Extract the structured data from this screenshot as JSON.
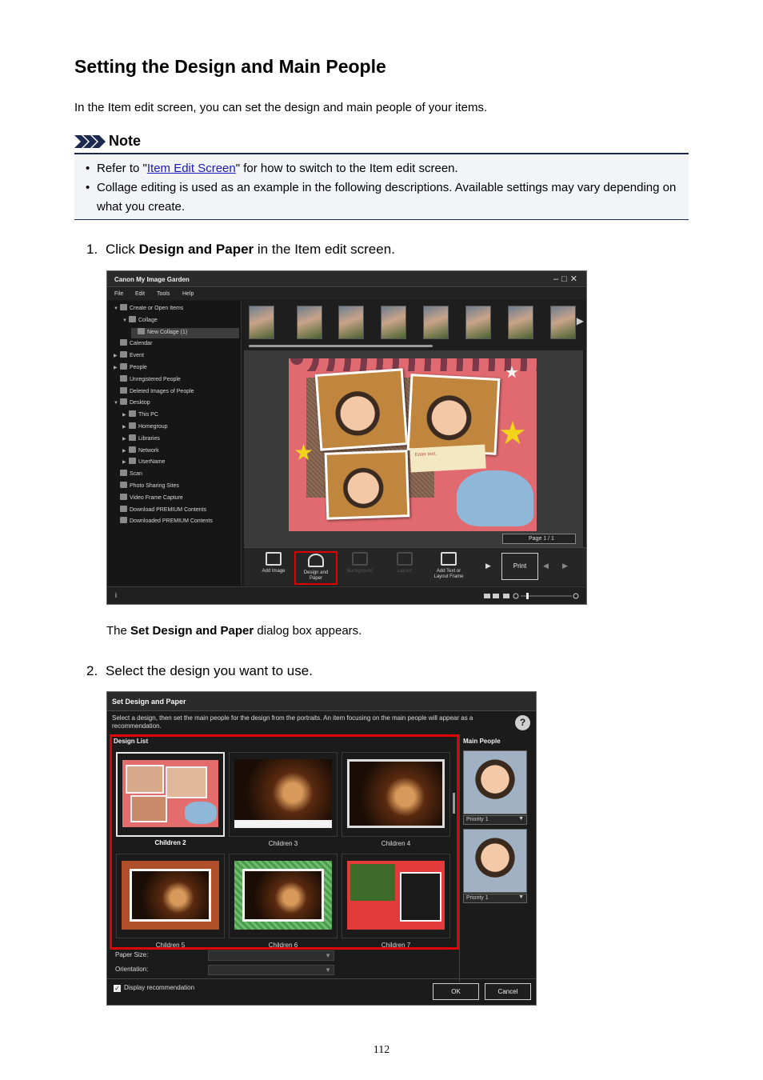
{
  "doc": {
    "title": "Setting the Design and Main People",
    "intro": "In the Item edit screen, you can set the design and main people of your items.",
    "note": {
      "label": "Note",
      "item1_pre": "Refer to \"",
      "item1_link": "Item Edit Screen",
      "item1_post": "\" for how to switch to the Item edit screen.",
      "item2": "Collage editing is used as an example in the following descriptions. Available settings may vary depending on what you create."
    },
    "step1": {
      "num": "1.",
      "pre": "Click ",
      "bold": "Design and Paper",
      "post": " in the Item edit screen."
    },
    "after1": {
      "pre": "The ",
      "bold": "Set Design and Paper",
      "post": " dialog box appears."
    },
    "step2": {
      "num": "2.",
      "text": "Select the design you want to use."
    },
    "page_number": "112"
  },
  "app": {
    "title": "Canon My Image Garden",
    "menu": [
      "File",
      "Edit",
      "Tools",
      "Help"
    ],
    "tree": [
      {
        "label": "Create or Open Items",
        "twisty": "▼",
        "depth": 0
      },
      {
        "label": "Collage",
        "twisty": "▼",
        "depth": 1
      },
      {
        "label": "New Collage (1)",
        "twisty": "",
        "depth": 2
      },
      {
        "label": "Calendar",
        "twisty": "",
        "depth": 0
      },
      {
        "label": "Event",
        "twisty": "▶",
        "depth": 0
      },
      {
        "label": "People",
        "twisty": "▶",
        "depth": 0
      },
      {
        "label": "Unregistered People",
        "twisty": "",
        "depth": 0
      },
      {
        "label": "Deleted Images of People",
        "twisty": "",
        "depth": 0
      },
      {
        "label": "Desktop",
        "twisty": "▼",
        "depth": 0
      },
      {
        "label": "This PC",
        "twisty": "▶",
        "depth": 1
      },
      {
        "label": "Homegroup",
        "twisty": "▶",
        "depth": 1
      },
      {
        "label": "Libraries",
        "twisty": "▶",
        "depth": 1
      },
      {
        "label": "Network",
        "twisty": "▶",
        "depth": 1
      },
      {
        "label": "UserName",
        "twisty": "▶",
        "depth": 1
      },
      {
        "label": "Scan",
        "twisty": "",
        "depth": 0
      },
      {
        "label": "Photo Sharing Sites",
        "twisty": "",
        "depth": 0
      },
      {
        "label": "Video Frame Capture",
        "twisty": "",
        "depth": 0
      },
      {
        "label": "Download PREMIUM Contents",
        "twisty": "",
        "depth": 0
      },
      {
        "label": "Downloaded PREMIUM Contents",
        "twisty": "",
        "depth": 0
      }
    ],
    "collage_note_text": "Enter text.",
    "page_indicator": "Page 1 / 1",
    "tools": {
      "add_image": "Add Image",
      "design_paper_1": "Design and",
      "design_paper_2": "Paper",
      "background": "Background",
      "layout": "Layout",
      "add_text_1": "Add Text or",
      "add_text_2": "Layout Frame",
      "print": "Print"
    },
    "info_icon": "i"
  },
  "dialog": {
    "title": "Set Design and Paper",
    "instruction": "Select a design, then set the main people for the design from the portraits. An item focusing on the main people will appear as a recommendation.",
    "design_list_label": "Design List",
    "designs": [
      "Children 2",
      "Children 3",
      "Children 4",
      "Children 5",
      "Children 6",
      "Children 7"
    ],
    "main_people_label": "Main People",
    "priority_1": "Priority 1",
    "priority_2": "Priority 1",
    "paper_size_label": "Paper Size:",
    "orientation_label": "Orientation:",
    "display_recommendation": "Display recommendation",
    "ok": "OK",
    "cancel": "Cancel"
  }
}
